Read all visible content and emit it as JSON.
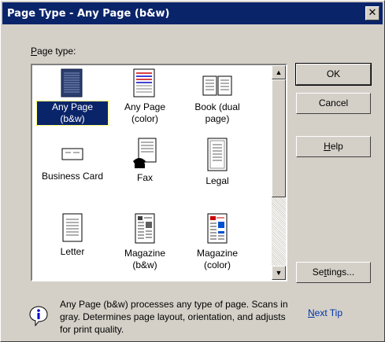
{
  "window": {
    "title": "Page Type - Any Page (b&w)",
    "close_label": "x"
  },
  "page_type_label_prefix": "P",
  "page_type_label_rest": "age type:",
  "items": [
    {
      "label": "Any Page (b&w)",
      "icon": "any-page-bw-icon",
      "selected": true
    },
    {
      "label": "Any Page (color)",
      "icon": "any-page-color-icon",
      "selected": false
    },
    {
      "label": "Book (dual page)",
      "icon": "book-dual-page-icon",
      "selected": false
    },
    {
      "label": "Business Card",
      "icon": "business-card-icon",
      "selected": false
    },
    {
      "label": "Fax",
      "icon": "fax-icon",
      "selected": false
    },
    {
      "label": "Legal",
      "icon": "legal-icon",
      "selected": false
    },
    {
      "label": "Letter",
      "icon": "letter-icon",
      "selected": false
    },
    {
      "label": "Magazine (b&w)",
      "icon": "magazine-bw-icon",
      "selected": false
    },
    {
      "label": "Magazine (color)",
      "icon": "magazine-color-icon",
      "selected": false
    }
  ],
  "buttons": {
    "ok": "OK",
    "cancel": "Cancel",
    "help_prefix": "H",
    "help_rest": "elp",
    "settings_prefix": "Se",
    "settings_underline": "t",
    "settings_rest": "tings..."
  },
  "tip": {
    "text": "Any Page (b&w) processes any type of page. Scans in gray. Determines page layout, orientation, and adjusts for print quality.",
    "next_prefix": "N",
    "next_rest": "ext Tip"
  },
  "colors": {
    "titlebar": "#0a246a",
    "selection": "#0a246a",
    "face": "#d4d0c8",
    "link": "#0033aa"
  }
}
